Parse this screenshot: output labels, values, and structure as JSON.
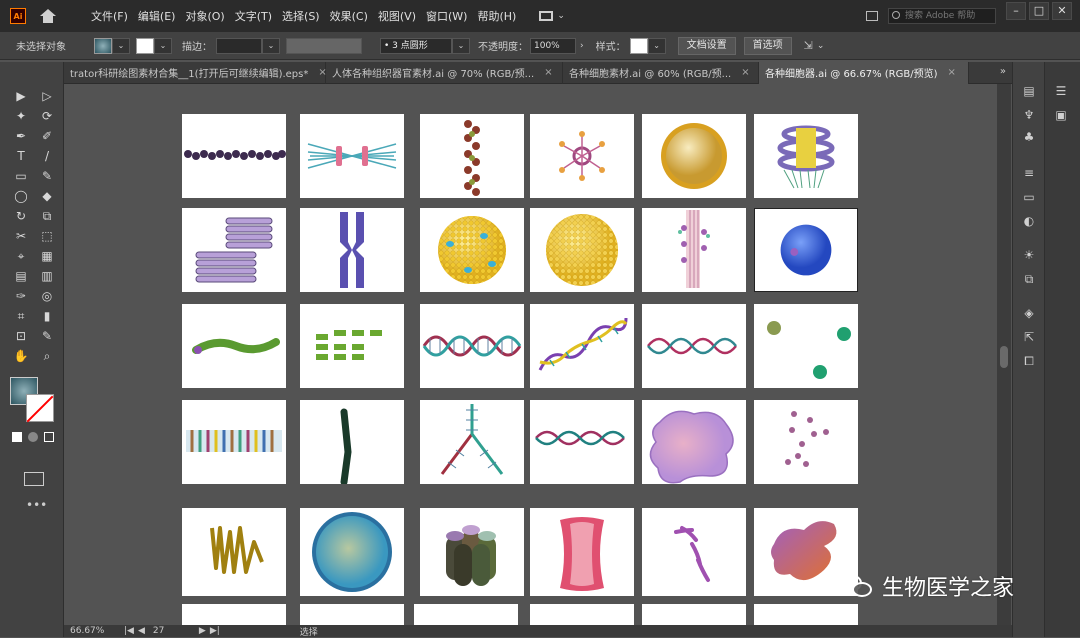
{
  "app": {
    "logo": "Ai",
    "menus": [
      "文件(F)",
      "编辑(E)",
      "对象(O)",
      "文字(T)",
      "选择(S)",
      "效果(C)",
      "视图(V)",
      "窗口(W)",
      "帮助(H)"
    ],
    "search_placeholder": "搜索 Adobe 帮助",
    "window_buttons": [
      "–",
      "□",
      "✕"
    ]
  },
  "control_bar": {
    "selection_status": "未选择对象",
    "stroke_label": "描边：",
    "brush_label": "3 点圆形",
    "opacity_label": "不透明度：",
    "opacity_value": "100%",
    "style_label": "样式：",
    "doc_setup_button": "文档设置",
    "prefs_button": "首选项"
  },
  "tabs": [
    {
      "label": "trator科研绘图素材合集__1(打开后可继续编辑).eps*",
      "active": false
    },
    {
      "label": "人体各种组织器官素材.ai @ 70% (RGB/预...",
      "active": false
    },
    {
      "label": "各种细胞素材.ai @ 60% (RGB/预...",
      "active": false
    },
    {
      "label": "各种细胞器.ai @ 66.67% (RGB/预览)",
      "active": true
    }
  ],
  "tools": [
    "▶",
    "▷",
    "✦",
    "⟳",
    "✒",
    "✐",
    "T",
    "/",
    "▭",
    "✎",
    "◯",
    "◆",
    "↻",
    "⧉",
    "✂",
    "⬚",
    "⌖",
    "▦",
    "▤",
    "▥",
    "✑",
    "◎",
    "⌗",
    "▮",
    "⊡",
    "✎",
    "✋",
    "⌕"
  ],
  "status": {
    "zoom": "66.67%",
    "page": "27",
    "mode": "选择"
  },
  "watermark": "生物医学之家",
  "colors": {
    "menubar": "#2b2b2b",
    "canvas": "#535353",
    "tile": "#ffffff"
  }
}
